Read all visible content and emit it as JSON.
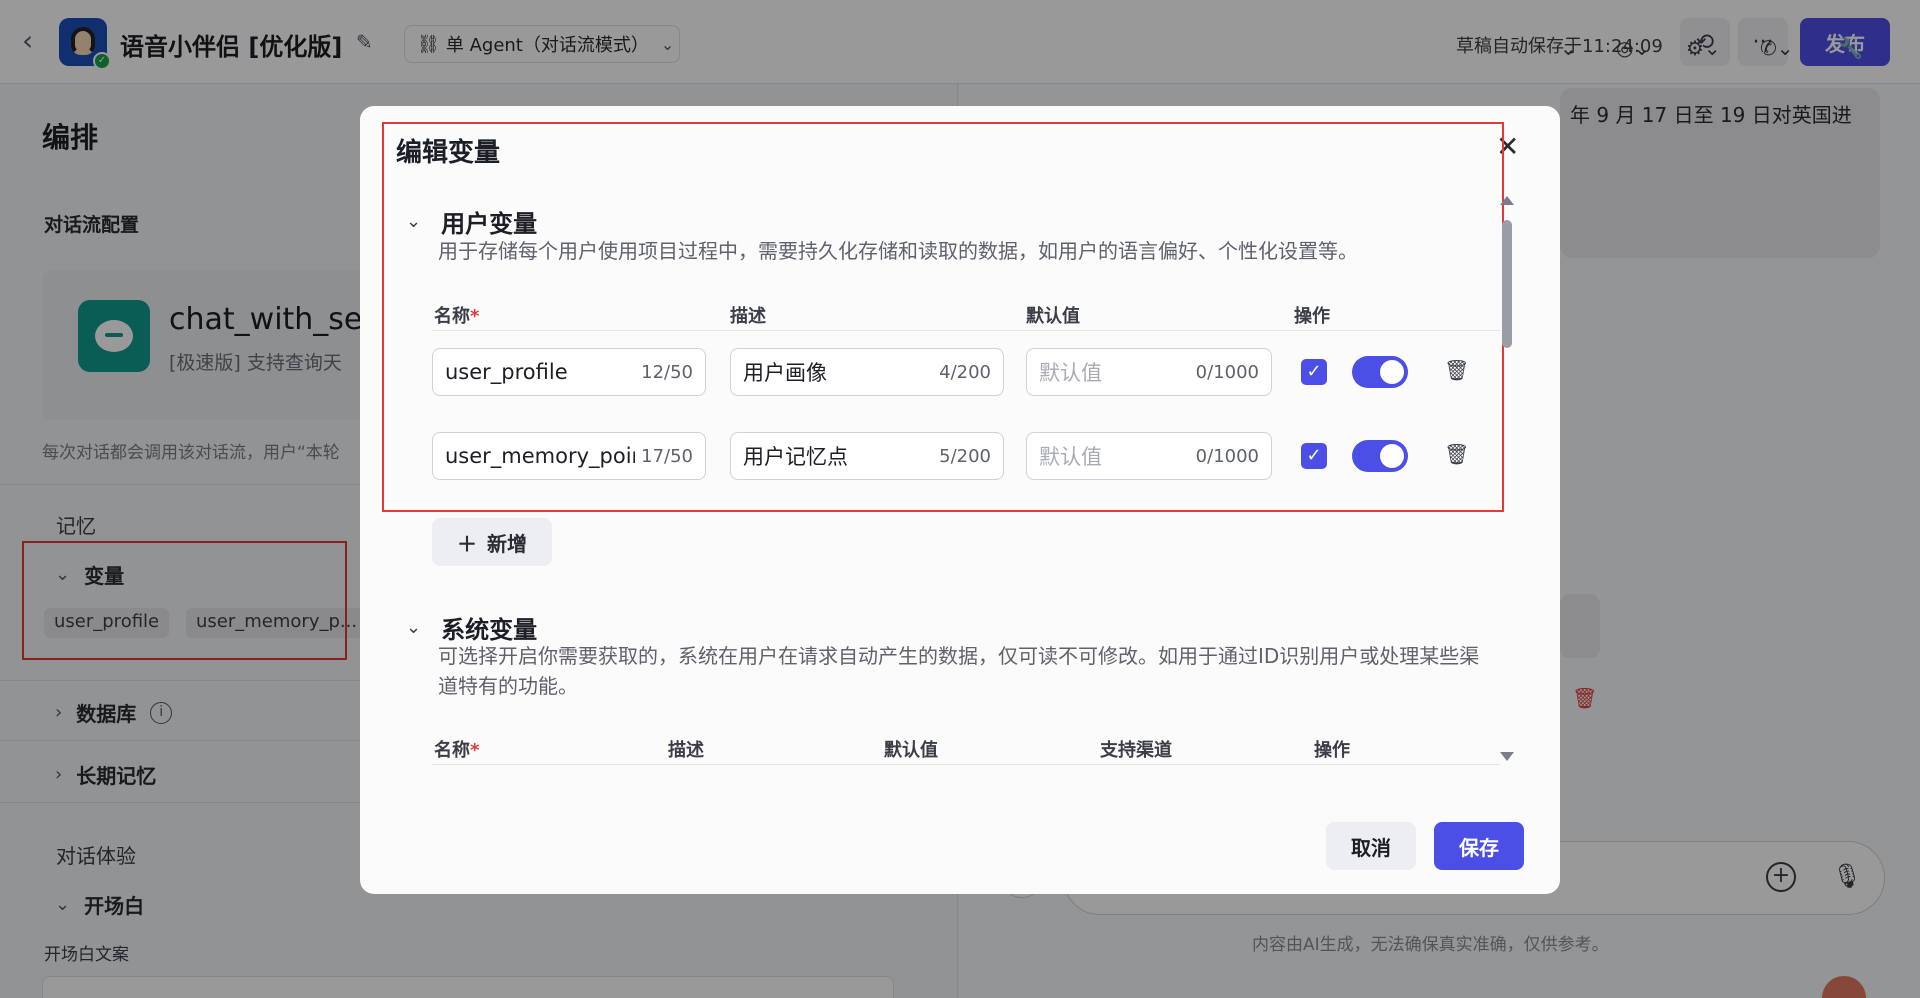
{
  "topbar": {
    "back_icon": "chevron-left-icon",
    "app_name": "语音小伴侣 [优化版]",
    "mode_label": "单 Agent（对话流模式）",
    "autosave": "草稿自动保存于11:24:09",
    "publish_label": "发布"
  },
  "left": {
    "title": "编排",
    "flow_config_label": "对话流配置",
    "flow_name": "chat_with_se",
    "flow_desc": "[极速版] 支持查询天",
    "hint": "每次对话都会调用该对话流，用户“本轮",
    "memory_label": "记忆",
    "variables_label": "变量",
    "chips": [
      "user_profile",
      "user_memory_p..."
    ],
    "database_label": "数据库",
    "longterm_label": "长期记忆",
    "experience_label": "对话体验",
    "opening_label": "开场白",
    "opening_text_label": "开场白文案"
  },
  "right": {
    "message": "年 9 月 17 日至 19 日对英国进",
    "footer": "内容由AI生成，无法确保真实准确，仅供参考。"
  },
  "modal": {
    "title": "编辑变量",
    "user_section": {
      "title": "用户变量",
      "desc": "用于存储每个用户使用项目过程中，需要持久化存储和读取的数据，如用户的语言偏好、个性化设置等。",
      "headers": {
        "name": "名称",
        "desc": "描述",
        "default": "默认值",
        "action": "操作"
      },
      "rows": [
        {
          "name": "user_profile",
          "name_count": "12/50",
          "desc": "用户画像",
          "desc_count": "4/200",
          "default_placeholder": "默认值",
          "default_count": "0/1000"
        },
        {
          "name": "user_memory_poir",
          "name_count": "17/50",
          "desc": "用户记忆点",
          "desc_count": "5/200",
          "default_placeholder": "默认值",
          "default_count": "0/1000"
        }
      ],
      "add_label": "新增"
    },
    "system_section": {
      "title": "系统变量",
      "desc": "可选择开启你需要获取的，系统在用户在请求自动产生的数据，仅可读不可修改。如用于通过ID识别用户或处理某些渠道特有的功能。",
      "headers": {
        "name": "名称",
        "desc": "描述",
        "default": "默认值",
        "channel": "支持渠道",
        "action": "操作"
      }
    },
    "cancel_label": "取消",
    "save_label": "保存",
    "required_mark": "*"
  },
  "colors": {
    "accent": "#4c4fe6",
    "danger": "#e53935",
    "overlay": "rgba(0,0,0,0.40)"
  }
}
